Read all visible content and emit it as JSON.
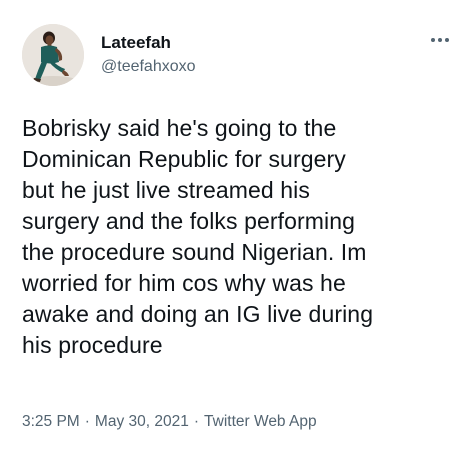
{
  "author": {
    "name": "Lateefah",
    "handle": "@teefahxoxo"
  },
  "tweet": {
    "text": "Bobrisky said he's going to the\nDominican Republic  for surgery\nbut he just live streamed his\nsurgery and the folks performing\nthe procedure sound Nigerian. Im\nworried for him cos why was he\nawake and doing an IG live during\nhis procedure"
  },
  "meta": {
    "time": "3:25 PM",
    "separator": "·",
    "date": "May 30, 2021",
    "source": "Twitter Web App"
  },
  "icons": {
    "more": "more-dots-icon",
    "avatar": "profile-photo"
  },
  "colors": {
    "text_primary": "#0f1419",
    "text_secondary": "#536471",
    "background": "#ffffff"
  }
}
